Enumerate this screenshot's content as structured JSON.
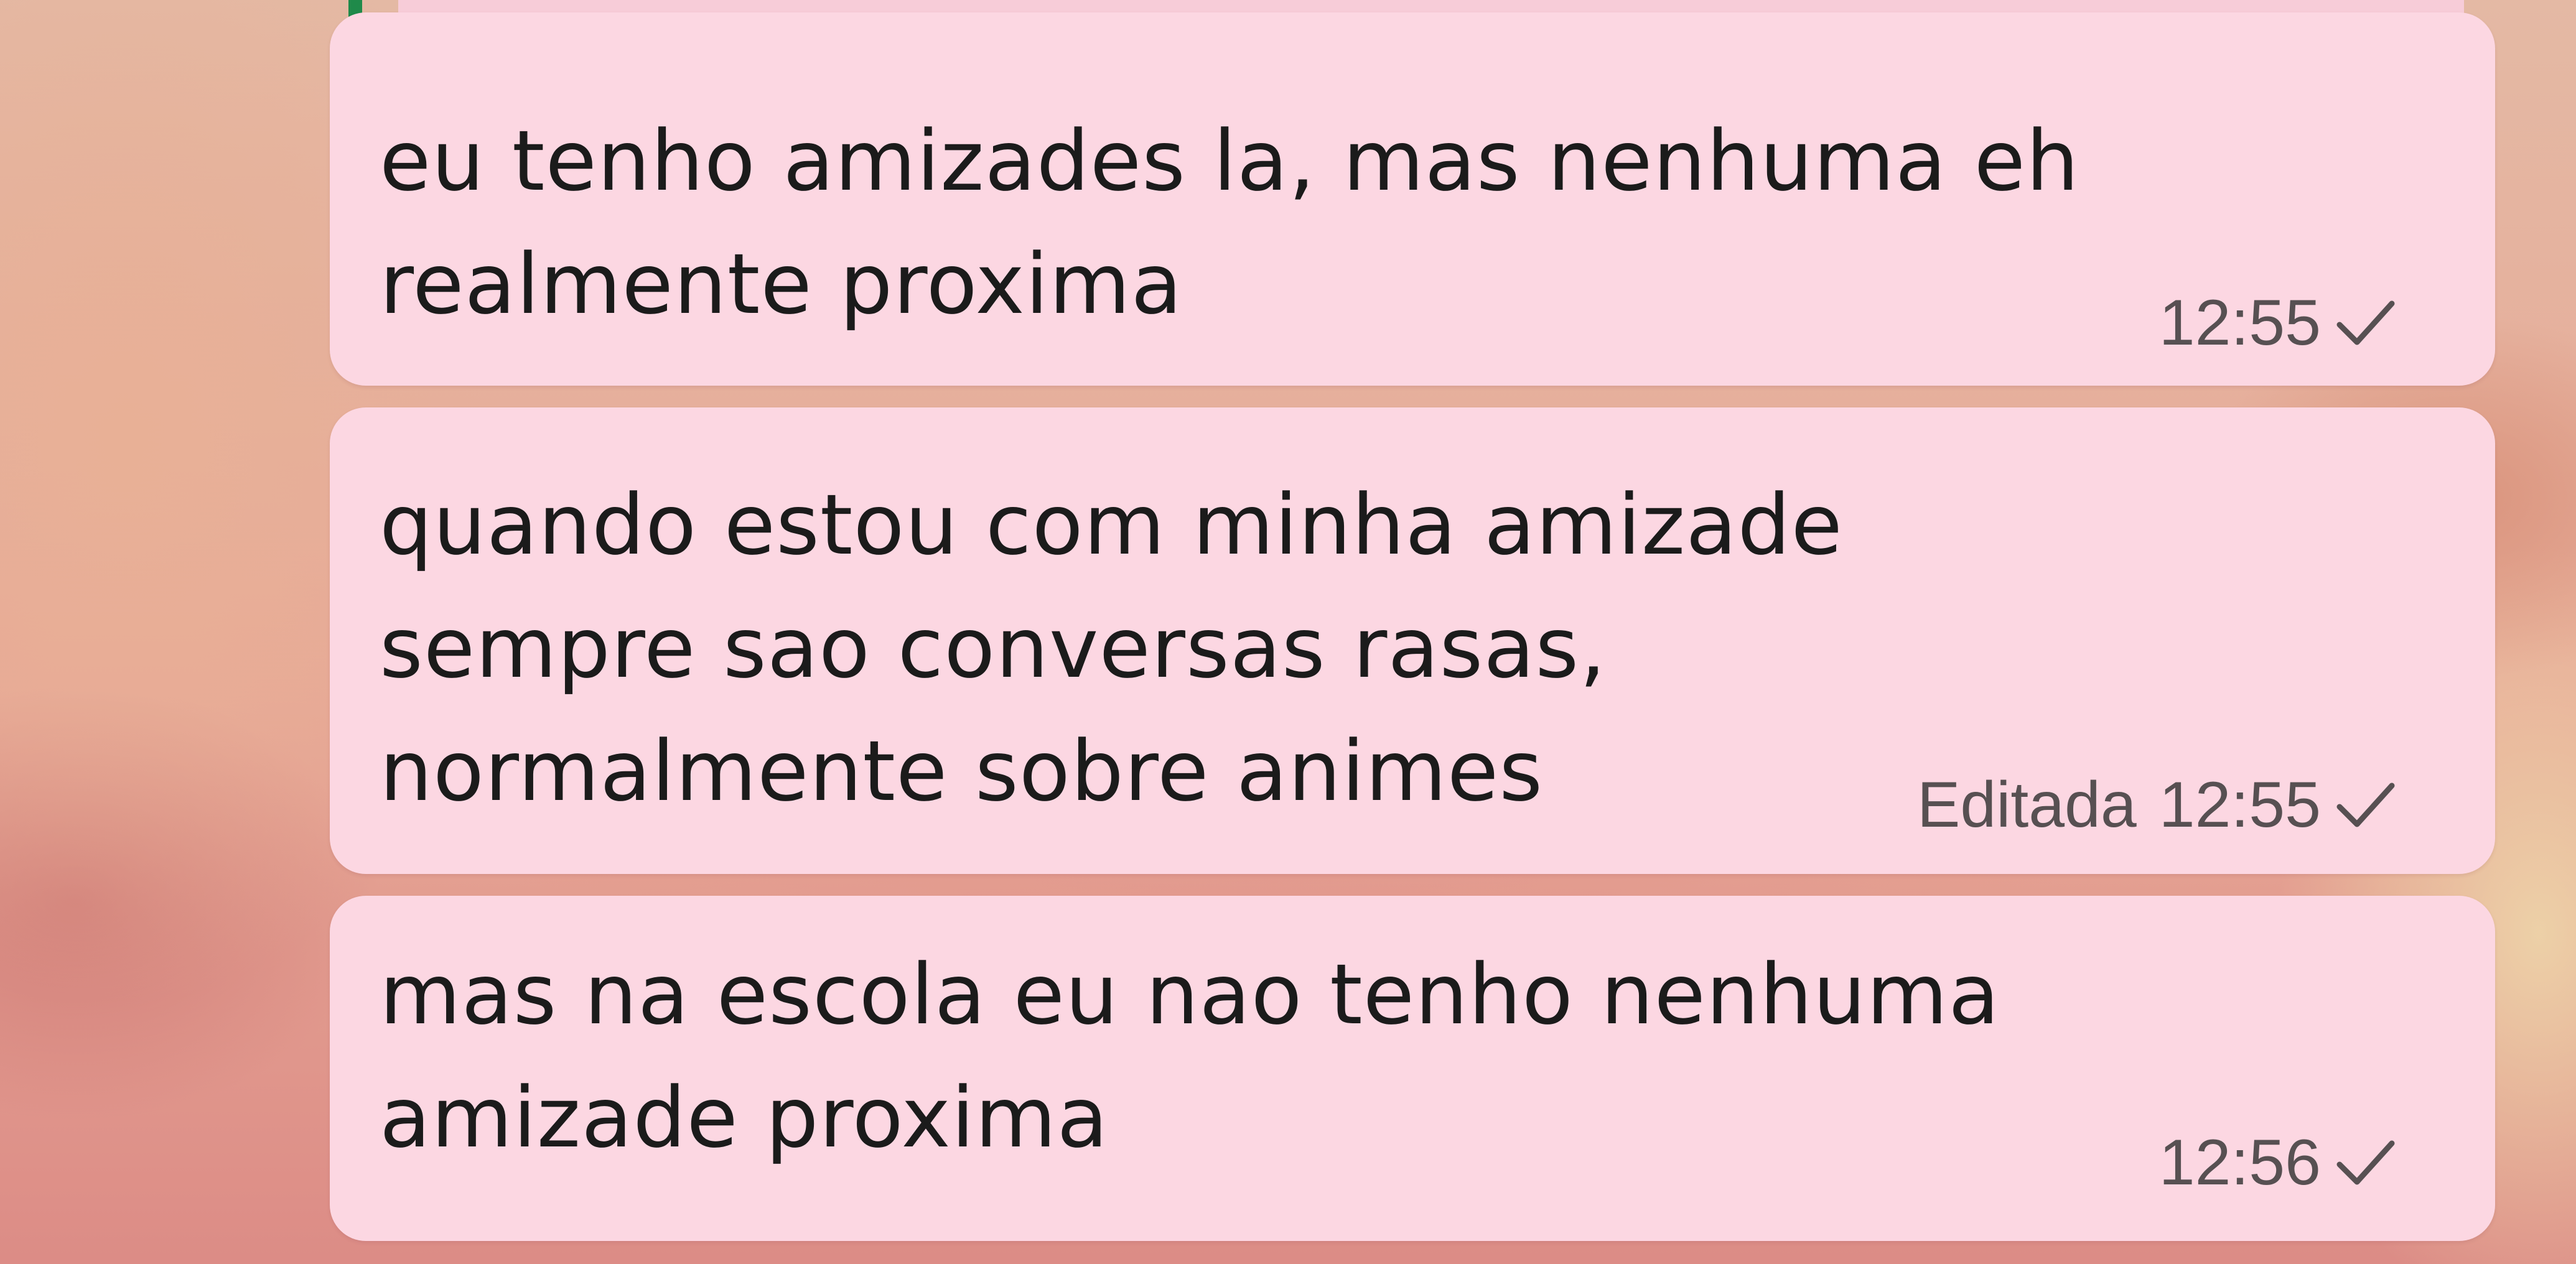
{
  "messages": [
    {
      "text": "eu tenho amizades la, mas nenhuma eh\nrealmente proxima",
      "edited_label": "",
      "time": "12:55",
      "status_icon": "single-check-icon"
    },
    {
      "text": "quando estou com minha amizade\nsempre sao conversas rasas,\nnormalmente sobre animes",
      "edited_label": "Editada",
      "time": "12:55",
      "status_icon": "single-check-icon"
    },
    {
      "text": "mas na escola eu nao tenho nenhuma\namizade proxima",
      "edited_label": "",
      "time": "12:56",
      "status_icon": "single-check-icon"
    }
  ],
  "colors": {
    "bubble": "#fcd7e2",
    "text": "#1b1b1b",
    "meta": "#575052",
    "quote_accent": "#1f8a4a"
  }
}
